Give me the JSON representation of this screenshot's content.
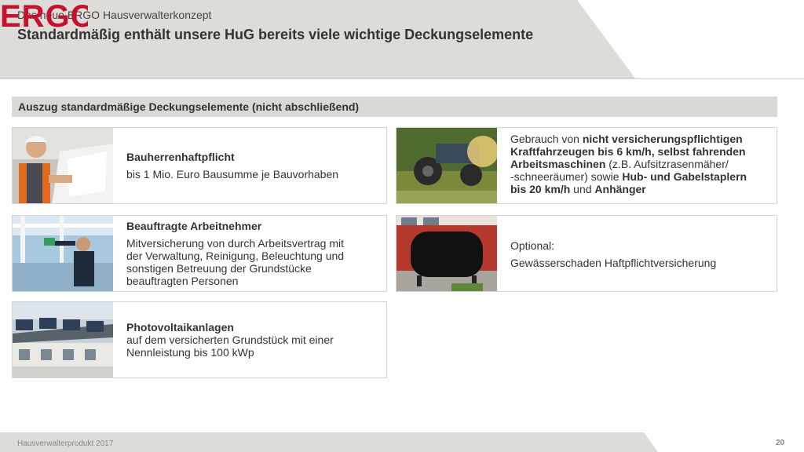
{
  "header": {
    "kicker": "Das neue ERGO Hausverwalterkonzept",
    "title": "Standardmäßig enthält unsere HuG bereits viele wichtige Deckungselemente",
    "logo_text": "ERGO",
    "brand_color": "#c8102e"
  },
  "section": {
    "heading": "Auszug standardmäßige Deckungselemente (nicht abschließend)"
  },
  "cards": {
    "bauherren": {
      "image": "construction-worker-with-plans",
      "title": "Bauherrenhaftpflicht",
      "text": "bis 1 Mio. Euro Bausumme je Bauvorhaben"
    },
    "arbeitnehmer": {
      "image": "window-cleaner",
      "title": "Beauftragte Arbeitnehmer",
      "line1": "Mitversicherung von durch Arbeitsvertrag mit",
      "line2": "der Verwaltung, Reinigung, Beleuchtung und",
      "line3": "sonstigen Betreuung der Grundstücke",
      "line4": "beauftragten Personen"
    },
    "photovoltaik": {
      "image": "solar-panels-on-houses",
      "title": "Photovoltaikanlagen",
      "line1": "auf dem versicherten Grundstück mit einer",
      "line2": "Nennleistung bis 100 kWp"
    },
    "fahrzeuge": {
      "image": "lawn-mower",
      "l1_pre": "Gebrauch von ",
      "l1_bold": "nicht versicherungspflichtigen",
      "l2_bold": "Kraftfahrzeugen bis 6 km/h, selbst fahrenden",
      "l3_bold": "Arbeitsmaschinen",
      "l3_rest": " (z.B. Aufsitzrasenmäher/",
      "l4_pre": "-schneeräumer) sowie ",
      "l4_bold": "Hub- und Gabelstaplern",
      "l5_bold": "bis 20 km/h",
      "l5_mid": " und ",
      "l5_bold2": "Anhänger"
    },
    "gewaesser": {
      "image": "oil-tank",
      "line1": "Optional:",
      "line2": "Gewässerschaden Haftpflichtversicherung"
    }
  },
  "footer": {
    "left": "Hausverwalterprodukt 2017",
    "page": "20"
  }
}
